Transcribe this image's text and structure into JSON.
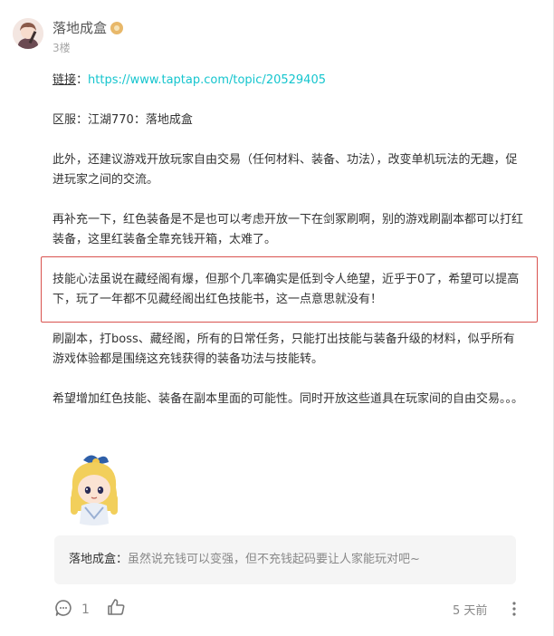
{
  "post": {
    "username": "落地成盒",
    "floor": "3楼",
    "link_label": "链接",
    "link_colon": "：",
    "link_url": "https://www.taptap.com/topic/20529405",
    "server": "区服：江湖770：落地成盒",
    "para1": "此外，还建议游戏开放玩家自由交易（任何材料、装备、功法），改变单机玩法的无趣，促进玩家之间的交流。",
    "para2": "再补充一下，红色装备是不是也可以考虑开放一下在剑冢刷啊，别的游戏刷副本都可以打红装备，这里红装备全靠充钱开箱，太难了。",
    "para3": "技能心法虽说在藏经阁有爆，但那个几率确实是低到令人绝望，近乎于0了，希望可以提高下，玩了一年都不见藏经阁出红色技能书，这一点意思就没有！",
    "para4": "刷副本，打boss、藏经阁，所有的日常任务，只能打出技能与装备升级的材料，似乎所有游戏体验都是围绕这充钱获得的装备功法与技能转。",
    "para5": "希望增加红色技能、装备在副本里面的可能性。同时开放这些道具在玩家间的自由交易。。。"
  },
  "reply": {
    "name": "落地成盒",
    "sep": "：",
    "text": "虽然说充钱可以变强，但不充钱起码要让人家能玩对吧~"
  },
  "footer": {
    "comment_count": "1",
    "time": "5 天前"
  },
  "colors": {
    "link": "#15c5ce",
    "highlight_border": "#d9534f",
    "reply_bg": "#f5f5f5"
  },
  "icons": {
    "avatar": "avatar",
    "badge": "user-badge-icon",
    "sticker": "chibi-girl-sticker",
    "comment": "comment-icon",
    "like": "thumbs-up-icon",
    "more": "more-vertical-icon"
  }
}
